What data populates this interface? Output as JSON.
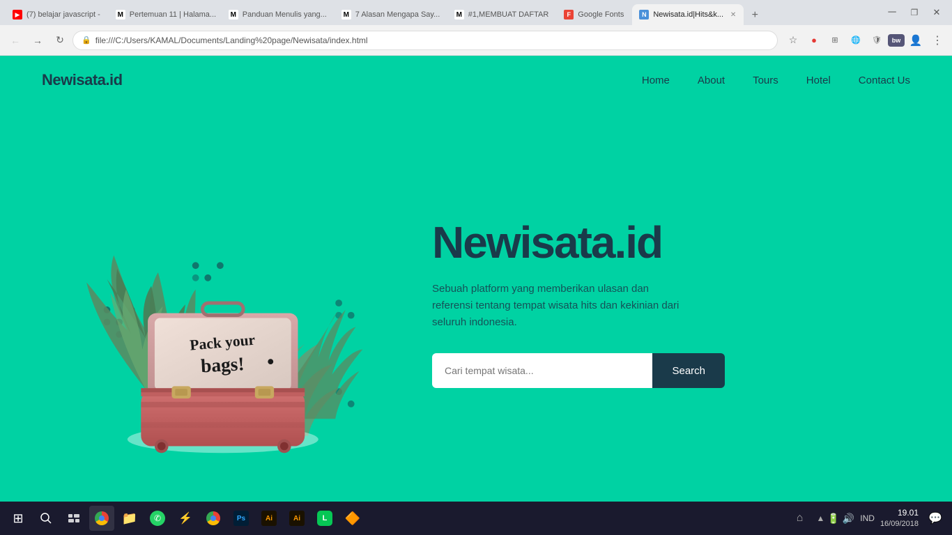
{
  "browser": {
    "tabs": [
      {
        "id": "tab1",
        "favicon_type": "yt",
        "label": "(7) belajar javascript -",
        "active": false
      },
      {
        "id": "tab2",
        "favicon_type": "m",
        "label": "Pertemuan 11 | Halam...",
        "active": false
      },
      {
        "id": "tab3",
        "favicon_type": "m",
        "label": "Panduan Menulis yang...",
        "active": false
      },
      {
        "id": "tab4",
        "favicon_type": "m",
        "label": "7 Alasan Mengapa Say...",
        "active": false
      },
      {
        "id": "tab5",
        "favicon_type": "m",
        "label": "#1,MEMBUAT DAFTAR",
        "active": false
      },
      {
        "id": "tab6",
        "favicon_type": "google",
        "label": "Google Fonts",
        "active": false
      },
      {
        "id": "tab7",
        "favicon_type": "active",
        "label": "Newisata.id|Hits&k...",
        "active": true
      }
    ],
    "url": "file:///C:/Users/KAMAL/Documents/Landing%20page/Newisata/index.html"
  },
  "navbar": {
    "brand": "Newisata.id",
    "links": [
      {
        "label": "Home"
      },
      {
        "label": "About"
      },
      {
        "label": "Tours"
      },
      {
        "label": "Hotel"
      },
      {
        "label": "Contact Us"
      }
    ]
  },
  "hero": {
    "title": "Newisata.id",
    "subtitle": "Sebuah platform yang memberikan ulasan dan referensi tentang tempat wisata hits dan kekinian dari seluruh indonesia.",
    "search_placeholder": "Cari tempat wisata...",
    "search_button": "Search"
  },
  "taskbar": {
    "time": "19.01",
    "date": "16/09/2018",
    "language": "IND"
  }
}
